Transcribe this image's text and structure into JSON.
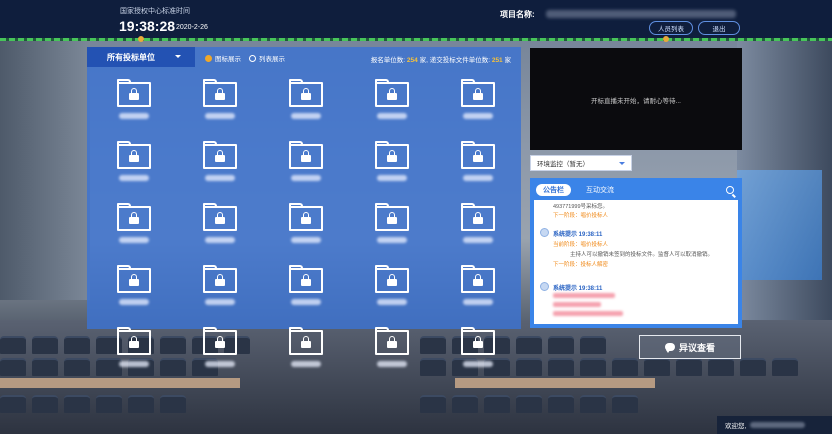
{
  "header": {
    "clock_label": "国家授权中心标准时间",
    "time": "19:38:28",
    "date": "2020-2-26",
    "project_label": "项目名称:",
    "buttons": [
      "人员列表",
      "退出"
    ]
  },
  "bidders": {
    "dropdown_label": "所有投标单位",
    "view_options": [
      {
        "label": "图标展示",
        "selected": true
      },
      {
        "label": "列表展示",
        "selected": false
      }
    ],
    "counts": {
      "registered_prefix": "报名单位数:",
      "registered": "254",
      "registered_unit": "家,",
      "submitted_prefix": "递交投标文件单位数:",
      "submitted": "251",
      "submitted_unit": "家"
    },
    "folder_icon": "locked-folder-icon",
    "visible_folders": 25
  },
  "video": {
    "message": "开标直播未开始，请耐心等待..."
  },
  "monitor": {
    "selected": "环境监控（暂无）"
  },
  "announcement": {
    "tabs": [
      "公告栏",
      "互动交流"
    ],
    "messages": [
      {
        "lines": [
          {
            "text": "493771999号采标您。",
            "style": "gray"
          },
          {
            "text": "下一阶段：唱价投标人",
            "style": "orange"
          }
        ]
      },
      {
        "sender": "系统提示 19:38:11",
        "lines": [
          {
            "text": "当前阶段：唱价投标人",
            "style": "orange"
          },
          {
            "text": "主持人可以撤销未签到的投标文件。监督人可以取消撤销。",
            "style": "gray"
          },
          {
            "text": "下一阶段：投标人解密",
            "style": "orange"
          }
        ]
      },
      {
        "sender": "系统提示 19:38:11"
      }
    ]
  },
  "objection_button": "异议查看",
  "welcome_label": "欢迎您,",
  "colors": {
    "topbar": "#0f1e3d",
    "panel": "#3c73d2",
    "accent_orange": "#f0a82a",
    "announcement": "#3a84e8"
  }
}
